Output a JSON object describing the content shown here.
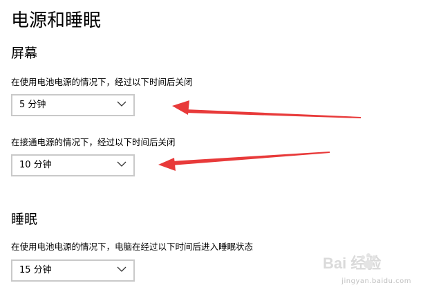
{
  "page": {
    "title": "电源和睡眠"
  },
  "screen": {
    "section_title": "屏幕",
    "battery_label": "在使用电池电源的情况下，经过以下时间后关闭",
    "battery_value": "5 分钟",
    "plugged_label": "在接通电源的情况下，经过以下时间后关闭",
    "plugged_value": "10 分钟"
  },
  "sleep": {
    "section_title": "睡眠",
    "battery_label": "在使用电池电源的情况下，电脑在经过以下时间后进入睡眠状态",
    "battery_value": "15 分钟"
  },
  "annotation": {
    "arrow_color": "#e83a3a"
  },
  "watermark": {
    "brand_text": "Bai 经验",
    "url_text": "jingyan.baidu.com"
  }
}
